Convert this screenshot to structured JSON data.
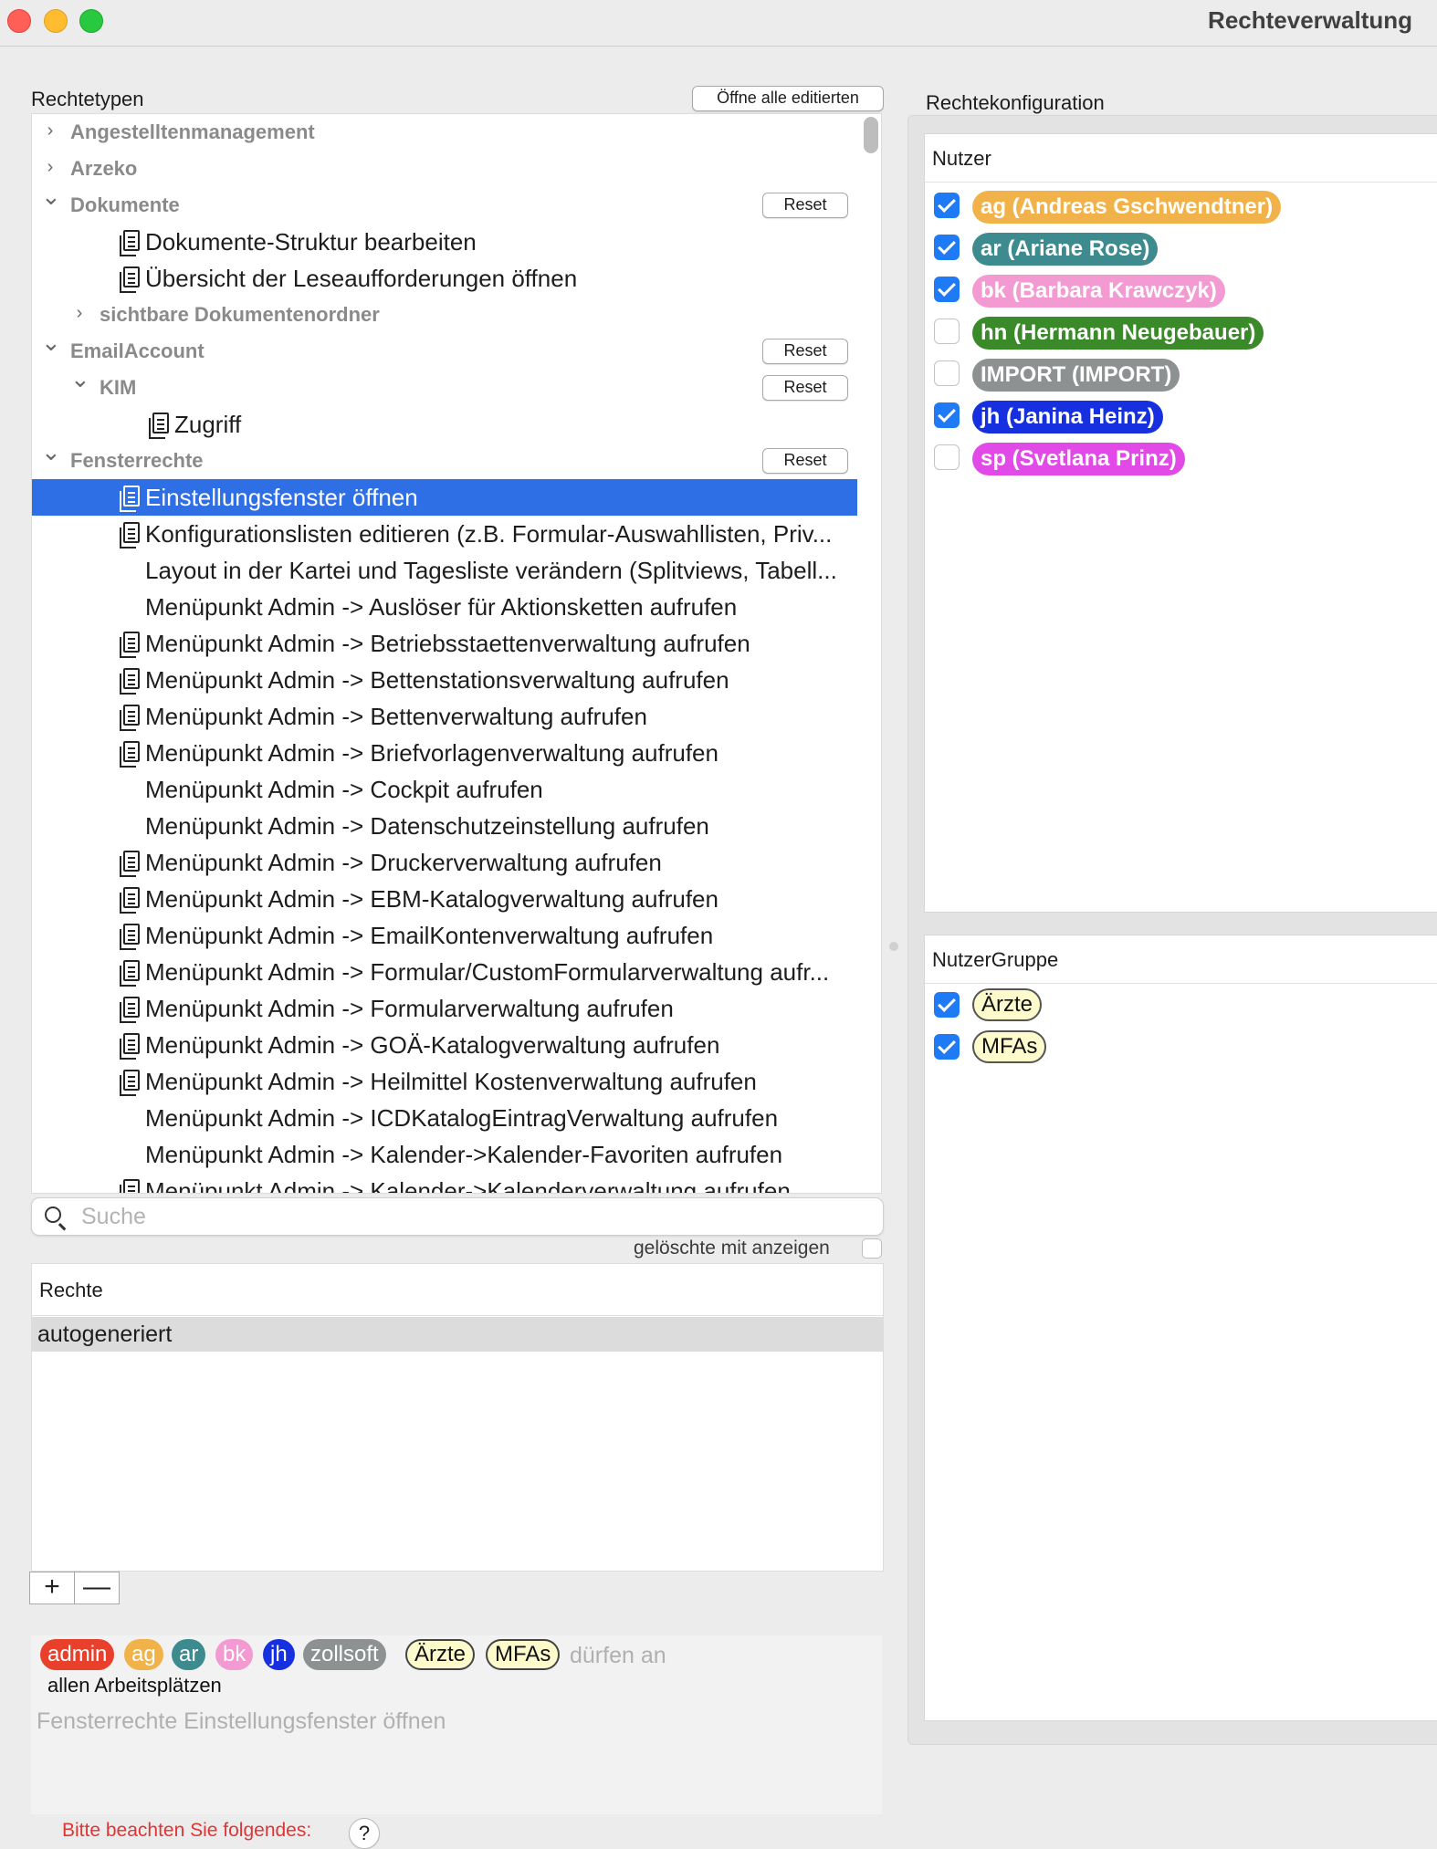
{
  "window": {
    "title": "Rechteverwaltung"
  },
  "left": {
    "rights_types_label": "Rechtetypen",
    "open_all_edited_button": "Öffne alle editierten",
    "tree": {
      "reset_label": "Reset",
      "rows": [
        {
          "text": "Angestelltenmanagement",
          "kind": "group",
          "level": 0,
          "chevron": "right",
          "reset": false
        },
        {
          "text": "Arzeko",
          "kind": "group",
          "level": 0,
          "chevron": "right",
          "reset": false
        },
        {
          "text": "Dokumente",
          "kind": "group",
          "level": 0,
          "chevron": "down",
          "reset": true
        },
        {
          "text": "Dokumente-Struktur bearbeiten",
          "kind": "leaf",
          "level": 1,
          "icon": true
        },
        {
          "text": "Übersicht der Leseaufforderungen öffnen",
          "kind": "leaf",
          "level": 1,
          "icon": true
        },
        {
          "text": "sichtbare Dokumentenordner",
          "kind": "group",
          "level": 1,
          "chevron": "right",
          "reset": false
        },
        {
          "text": "EmailAccount",
          "kind": "group",
          "level": 0,
          "chevron": "down",
          "reset": true
        },
        {
          "text": "KIM",
          "kind": "group",
          "level": 1,
          "chevron": "down",
          "reset": true
        },
        {
          "text": "Zugriff",
          "kind": "leaf",
          "level": 2,
          "icon": true
        },
        {
          "text": "Fensterrechte",
          "kind": "group",
          "level": 0,
          "chevron": "down",
          "reset": true
        },
        {
          "text": "Einstellungsfenster öffnen",
          "kind": "leaf",
          "level": 1,
          "icon": true,
          "selected": true
        },
        {
          "text": "Konfigurationslisten editieren (z.B. Formular-Auswahllisten, Priv...",
          "kind": "leaf",
          "level": 1,
          "icon": true
        },
        {
          "text": "Layout in der Kartei und Tagesliste verändern (Splitviews, Tabell...",
          "kind": "leaf",
          "level": 1,
          "icon": false
        },
        {
          "text": "Menüpunkt Admin -> Auslöser für Aktionsketten aufrufen",
          "kind": "leaf",
          "level": 1,
          "icon": false
        },
        {
          "text": "Menüpunkt Admin -> Betriebsstaettenverwaltung aufrufen",
          "kind": "leaf",
          "level": 1,
          "icon": true
        },
        {
          "text": "Menüpunkt Admin -> Bettenstationsverwaltung aufrufen",
          "kind": "leaf",
          "level": 1,
          "icon": true
        },
        {
          "text": "Menüpunkt Admin -> Bettenverwaltung aufrufen",
          "kind": "leaf",
          "level": 1,
          "icon": true
        },
        {
          "text": "Menüpunkt Admin -> Briefvorlagenverwaltung aufrufen",
          "kind": "leaf",
          "level": 1,
          "icon": true
        },
        {
          "text": "Menüpunkt Admin -> Cockpit aufrufen",
          "kind": "leaf",
          "level": 1,
          "icon": false
        },
        {
          "text": "Menüpunkt Admin -> Datenschutzeinstellung aufrufen",
          "kind": "leaf",
          "level": 1,
          "icon": false
        },
        {
          "text": "Menüpunkt Admin -> Druckerverwaltung aufrufen",
          "kind": "leaf",
          "level": 1,
          "icon": true
        },
        {
          "text": "Menüpunkt Admin -> EBM-Katalogverwaltung aufrufen",
          "kind": "leaf",
          "level": 1,
          "icon": true
        },
        {
          "text": "Menüpunkt Admin -> EmailKontenverwaltung aufrufen",
          "kind": "leaf",
          "level": 1,
          "icon": true
        },
        {
          "text": "Menüpunkt Admin -> Formular/CustomFormularverwaltung aufr...",
          "kind": "leaf",
          "level": 1,
          "icon": true
        },
        {
          "text": "Menüpunkt Admin -> Formularverwaltung aufrufen",
          "kind": "leaf",
          "level": 1,
          "icon": true
        },
        {
          "text": "Menüpunkt Admin -> GOÄ-Katalogverwaltung aufrufen",
          "kind": "leaf",
          "level": 1,
          "icon": true
        },
        {
          "text": "Menüpunkt Admin -> Heilmittel Kostenverwaltung aufrufen",
          "kind": "leaf",
          "level": 1,
          "icon": true
        },
        {
          "text": "Menüpunkt Admin -> ICDKatalogEintragVerwaltung aufrufen",
          "kind": "leaf",
          "level": 1,
          "icon": false
        },
        {
          "text": "Menüpunkt Admin -> Kalender->Kalender-Favoriten aufrufen",
          "kind": "leaf",
          "level": 1,
          "icon": false
        },
        {
          "text": "Menüpunkt Admin -> Kalender->Kalenderverwaltung aufrufen",
          "kind": "leaf",
          "level": 1,
          "icon": true
        }
      ]
    },
    "search": {
      "placeholder": "Suche"
    },
    "show_deleted_label": "gelöschte mit anzeigen",
    "rights": {
      "header": "Rechte",
      "rows": [
        "autogeneriert"
      ]
    },
    "add_label": "+",
    "remove_label": "—",
    "summary": {
      "pills": [
        {
          "text": "admin",
          "bg": "#e8402b",
          "fg": "#ffffff",
          "outlined": false
        },
        {
          "text": "ag",
          "bg": "#f2b24a",
          "fg": "#ffffff",
          "outlined": false
        },
        {
          "text": "ar",
          "bg": "#3d8b8e",
          "fg": "#ffffff",
          "outlined": false
        },
        {
          "text": "bk",
          "bg": "#f29ad1",
          "fg": "#ffffff",
          "outlined": false
        },
        {
          "text": "jh",
          "bg": "#1630e0",
          "fg": "#ffffff",
          "outlined": false
        },
        {
          "text": "zollsoft",
          "bg": "#8e9192",
          "fg": "#ffffff",
          "outlined": false
        },
        {
          "text": "Ärzte",
          "bg": "#fdfacc",
          "fg": "#111111",
          "outlined": true
        },
        {
          "text": "MFAs",
          "bg": "#fdfacc",
          "fg": "#111111",
          "outlined": true
        }
      ],
      "tail": "dürfen an",
      "line2": "allen Arbeitsplätzen",
      "line3": "Fensterrechte Einstellungsfenster öffnen"
    },
    "warning": "Bitte beachten Sie folgendes:",
    "help_label": "?"
  },
  "right": {
    "config_label": "Rechtekonfiguration",
    "users": {
      "header": "Nutzer",
      "items": [
        {
          "label": "ag (Andreas Gschwendtner)",
          "checked": true,
          "color": "#f2b24a"
        },
        {
          "label": "ar (Ariane Rose)",
          "checked": true,
          "color": "#3d8b8e"
        },
        {
          "label": "bk (Barbara Krawczyk)",
          "checked": true,
          "color": "#f29ad1"
        },
        {
          "label": "hn (Hermann Neugebauer)",
          "checked": false,
          "color": "#3a8a2a"
        },
        {
          "label": "IMPORT (IMPORT)",
          "checked": false,
          "color": "#8e9192"
        },
        {
          "label": "jh (Janina Heinz)",
          "checked": true,
          "color": "#1630e0"
        },
        {
          "label": "sp (Svetlana Prinz)",
          "checked": false,
          "color": "#e24ae8"
        }
      ]
    },
    "groups": {
      "header": "NutzerGruppe",
      "items": [
        {
          "label": "Ärzte",
          "checked": true
        },
        {
          "label": "MFAs",
          "checked": true
        }
      ]
    }
  }
}
